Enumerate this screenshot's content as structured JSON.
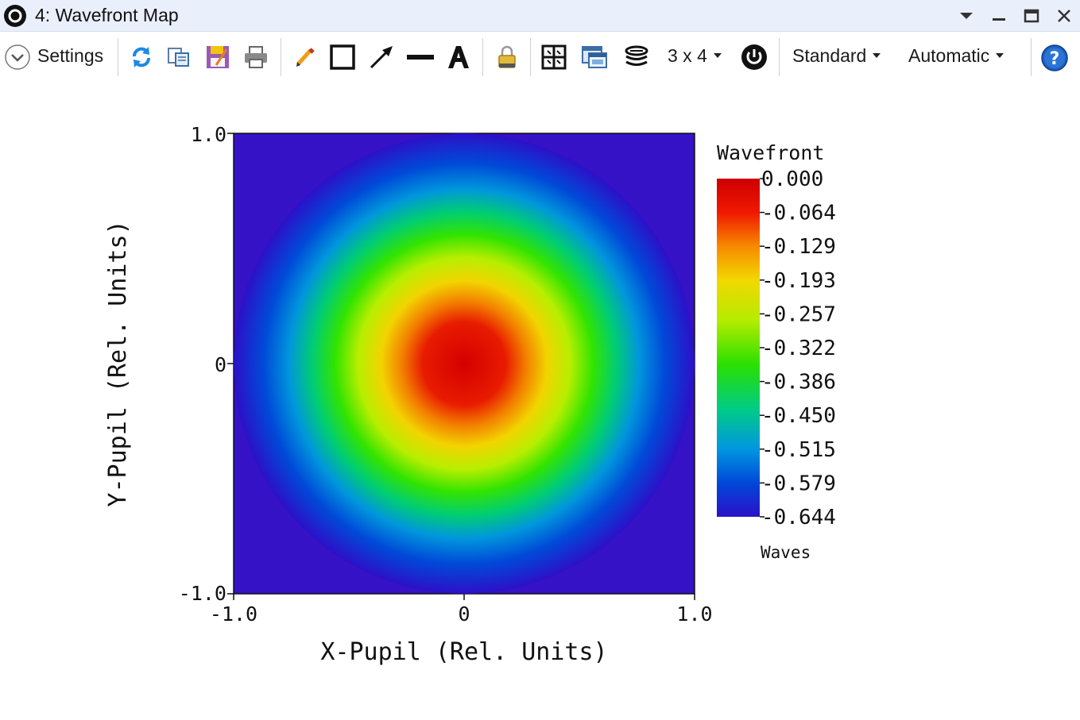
{
  "window": {
    "title": "4: Wavefront Map"
  },
  "toolbar": {
    "settings_label": "Settings",
    "layout_label": "3 x 4",
    "style_label": "Standard",
    "scale_label": "Automatic",
    "icons": [
      "chevron-down-icon",
      "refresh-icon",
      "copy-icon",
      "save-icon",
      "print-icon",
      "pencil-icon",
      "rectangle-icon",
      "arrow-icon",
      "line-icon",
      "text-icon",
      "lock-icon",
      "grid-icon",
      "window-icon",
      "layers-icon",
      "power-icon",
      "help-icon"
    ]
  },
  "chart_data": {
    "type": "heatmap",
    "title": "",
    "xlabel": "X-Pupil (Rel. Units)",
    "ylabel": "Y-Pupil (Rel. Units)",
    "x_ticks": [
      "-1.0",
      "0",
      "1.0"
    ],
    "y_ticks": [
      "1.0",
      "0",
      "-1.0"
    ],
    "xlim": [
      -1.0,
      1.0
    ],
    "ylim": [
      -1.0,
      1.0
    ],
    "colorbar": {
      "title": "Wavefront",
      "unit": "Waves",
      "ticks": [
        "0.000",
        "-0.064",
        "-0.129",
        "-0.193",
        "-0.257",
        "-0.322",
        "-0.386",
        "-0.450",
        "-0.515",
        "-0.579",
        "-0.644"
      ],
      "min": -0.644,
      "max": 0.0
    },
    "pupil_radius": 1.0,
    "center_value": 0.0,
    "edge_value": -0.644
  }
}
